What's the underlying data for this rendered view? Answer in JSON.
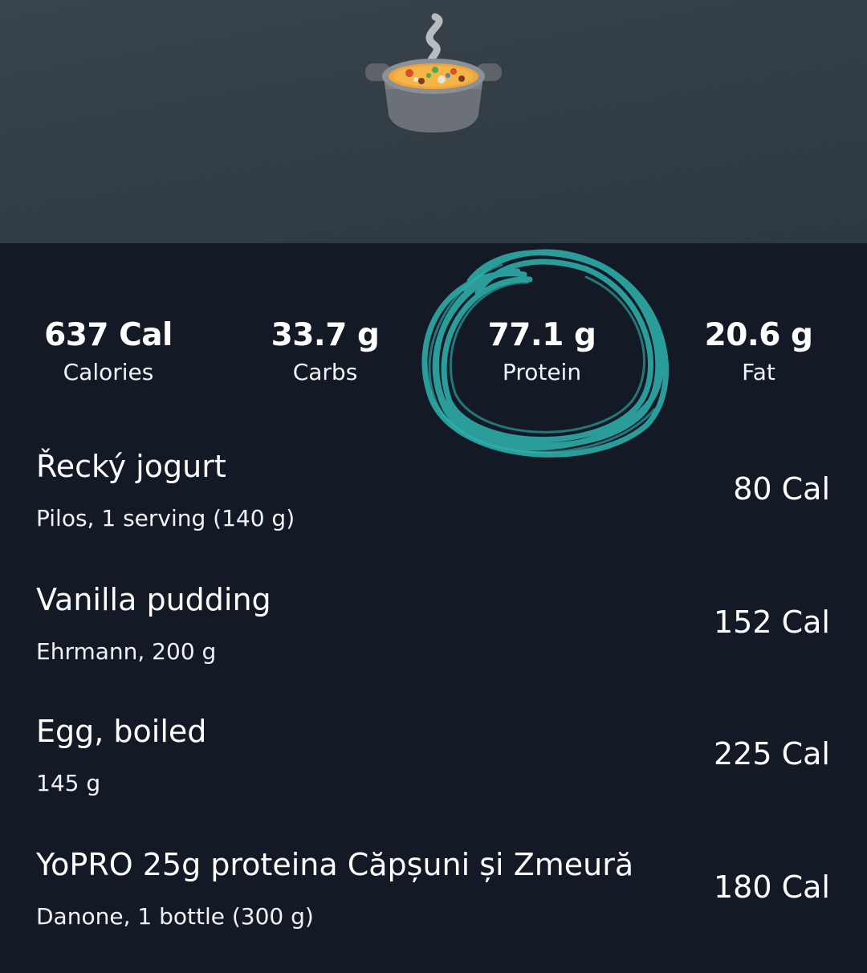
{
  "header": {
    "icon": "pot-of-food-icon"
  },
  "summary": {
    "calories": {
      "value": "637 Cal",
      "label": "Calories"
    },
    "carbs": {
      "value": "33.7 g",
      "label": "Carbs"
    },
    "protein": {
      "value": "77.1 g",
      "label": "Protein"
    },
    "fat": {
      "value": "20.6 g",
      "label": "Fat"
    },
    "highlight_color": "#2fb5b0"
  },
  "items": [
    {
      "name": "Řecký jogurt",
      "detail": "Pilos, 1 serving (140 g)",
      "calories": "80 Cal"
    },
    {
      "name": "Vanilla pudding",
      "detail": "Ehrmann, 200 g",
      "calories": "152 Cal"
    },
    {
      "name": "Egg, boiled",
      "detail": "145 g",
      "calories": "225 Cal"
    },
    {
      "name": "YoPRO 25g proteina Căpșuni și Zmeură",
      "detail": "Danone, 1 bottle (300 g)",
      "calories": "180 Cal"
    }
  ]
}
